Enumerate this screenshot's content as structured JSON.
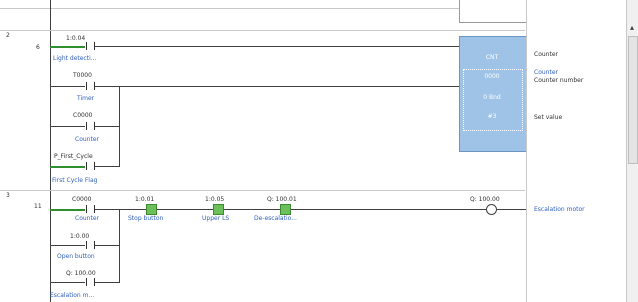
{
  "rungs": [
    {
      "number": "2",
      "step": "6"
    },
    {
      "number": "3",
      "step": "11"
    }
  ],
  "rung2": {
    "c1": {
      "address": "1:0.04",
      "comment": "Light detecti..."
    },
    "c2": {
      "address": "T0000",
      "comment": "Timer"
    },
    "c3": {
      "address": "C0000",
      "comment": "Counter"
    },
    "c4": {
      "address": "P_First_Cycle",
      "comment": "First Cycle Flag"
    },
    "block": {
      "name": "CNT",
      "operand1": "0000",
      "operand2": "0 Bnd",
      "operand3": "#3"
    },
    "annotations": {
      "a1": "Counter",
      "a2": "Counter",
      "a2b": "Counter number",
      "a3": "Set value"
    }
  },
  "rung3": {
    "c1": {
      "address": "C0000",
      "comment": "Counter"
    },
    "c2": {
      "address": "1:0.01",
      "comment": "Stop button"
    },
    "c3": {
      "address": "1:0.05",
      "comment": "Upper LS"
    },
    "c4": {
      "address": "Q: 100.01",
      "comment": "De-escalatio..."
    },
    "b1": {
      "address": "1:0.00",
      "comment": "Open button"
    },
    "b2": {
      "address": "Q: 100.00",
      "comment": "Escalation m..."
    },
    "coil": {
      "address": "Q: 100.00",
      "comment": "Escalation motor"
    }
  },
  "icons": {
    "scroll_up": "▴"
  },
  "colors": {
    "active_contact": "#6bc05a",
    "function_block": "#9ec3e6",
    "comment_text": "#3060c0"
  }
}
